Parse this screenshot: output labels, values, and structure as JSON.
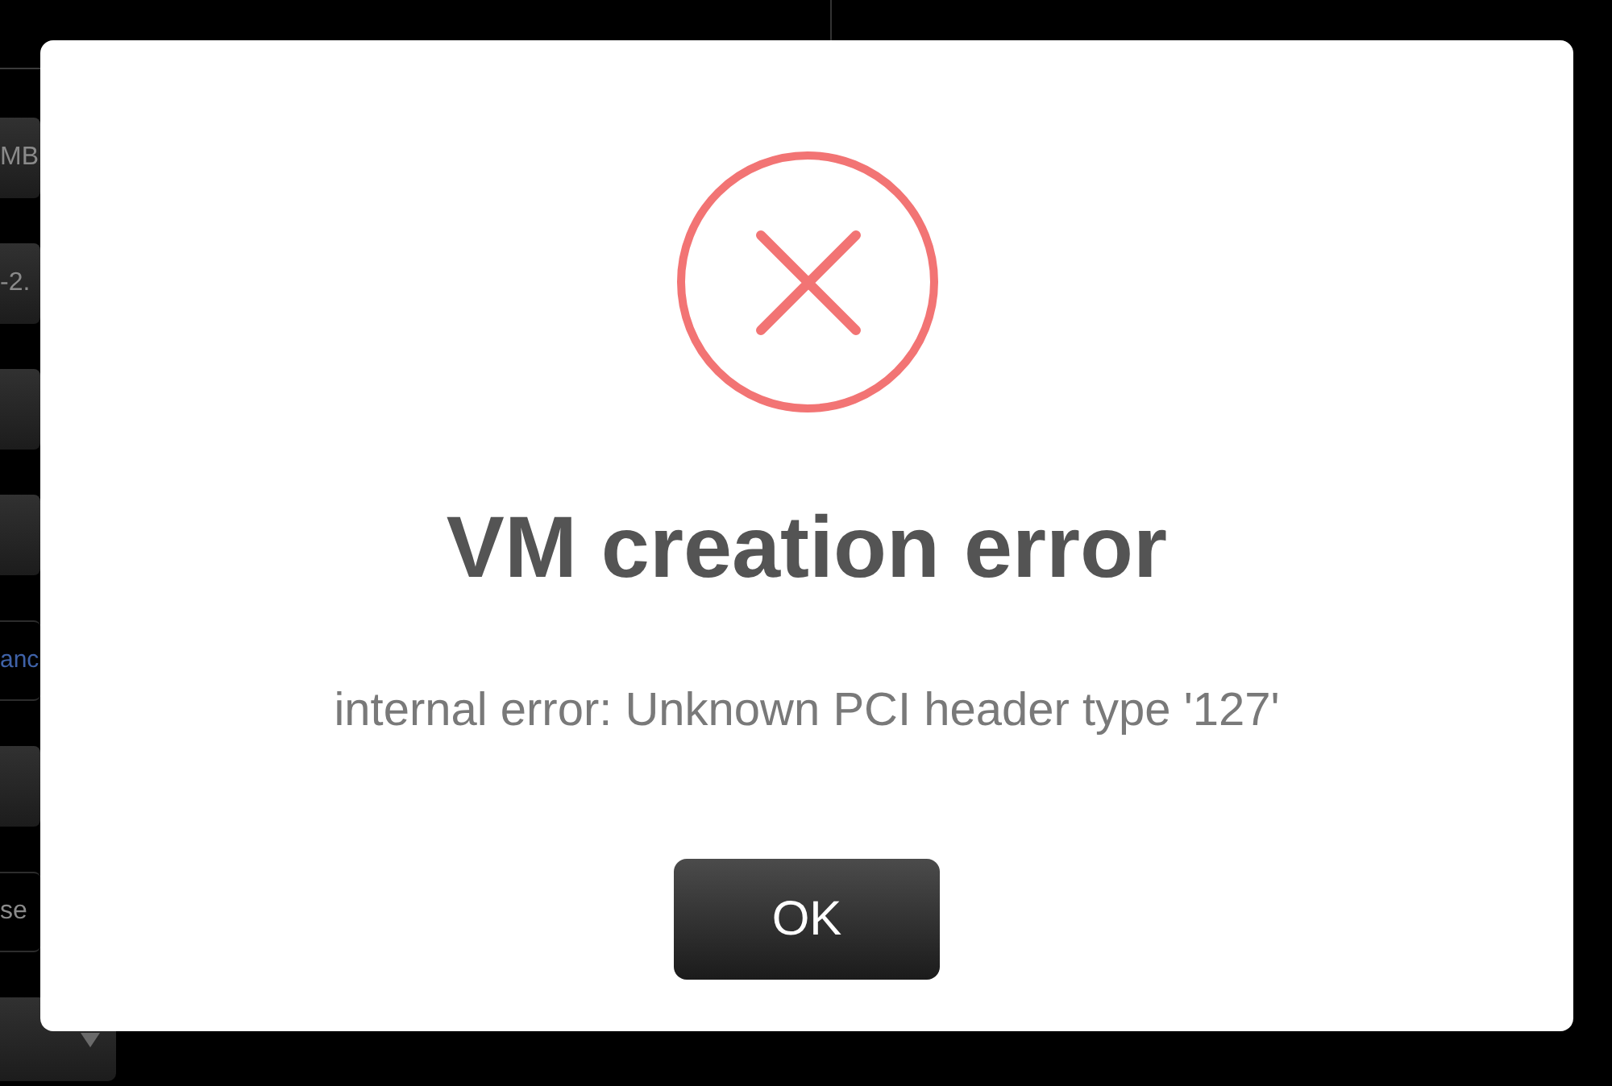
{
  "background": {
    "fields": [
      {
        "kind": "box",
        "text": "MB"
      },
      {
        "kind": "box",
        "text": "-2."
      },
      {
        "kind": "box"
      },
      {
        "kind": "box"
      },
      {
        "kind": "link",
        "text": "anc"
      },
      {
        "kind": "box"
      },
      {
        "kind": "input",
        "text": "se"
      },
      {
        "kind": "dropdown"
      }
    ]
  },
  "dialog": {
    "title": "VM creation error",
    "message": "internal error: Unknown PCI header type '127'",
    "buttons": [
      "OK"
    ]
  }
}
